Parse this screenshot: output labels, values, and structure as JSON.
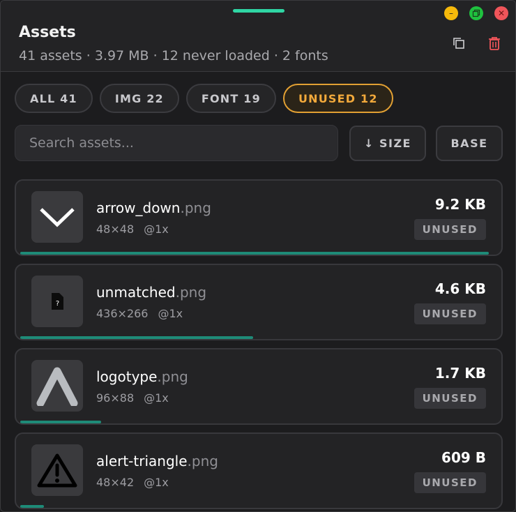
{
  "header": {
    "title": "Assets",
    "subtitle": "41 assets · 3.97 MB · 12 never loaded · 2 fonts",
    "icons": [
      "copy-icon",
      "trash-icon"
    ]
  },
  "window_controls": [
    "minimize",
    "maximize",
    "close"
  ],
  "filters": [
    {
      "label": "ALL 41",
      "active": false
    },
    {
      "label": "IMG 22",
      "active": false
    },
    {
      "label": "FONT 19",
      "active": false
    },
    {
      "label": "UNUSED 12",
      "active": true
    }
  ],
  "search": {
    "placeholder": "Search assets...",
    "value": ""
  },
  "toolbar": {
    "sort_label": "↓ SIZE",
    "base_label": "BASE"
  },
  "colors": {
    "accent_active": "#e2a033",
    "progress": "#1e8b78",
    "danger": "#f0555a"
  },
  "assets": [
    {
      "name": "arrow_down",
      "ext": ".png",
      "dims": "48×48",
      "scale": "@1x",
      "size": "9.2 KB",
      "status": "UNUSED",
      "thumb": "chevron-down-icon",
      "usage": 0.985
    },
    {
      "name": "unmatched",
      "ext": ".png",
      "dims": "436×266",
      "scale": "@1x",
      "size": "4.6 KB",
      "status": "UNUSED",
      "thumb": "unknown-file-icon",
      "usage": 0.49
    },
    {
      "name": "logotype",
      "ext": ".png",
      "dims": "96×88",
      "scale": "@1x",
      "size": "1.7 KB",
      "status": "UNUSED",
      "thumb": "logotype-icon",
      "usage": 0.17
    },
    {
      "name": "alert-triangle",
      "ext": ".png",
      "dims": "48×42",
      "scale": "@1x",
      "size": "609 B",
      "status": "UNUSED",
      "thumb": "alert-triangle-icon",
      "usage": 0.05
    }
  ]
}
